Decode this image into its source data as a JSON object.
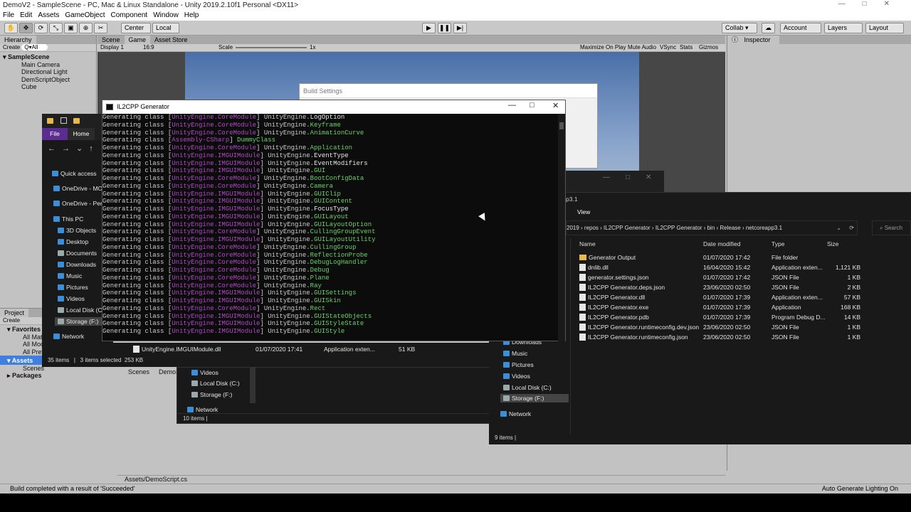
{
  "window": {
    "title": "DemoV2 - SampleScene - PC, Mac & Linux Standalone - Unity 2019.2.10f1 Personal <DX11>"
  },
  "menu": [
    "File",
    "Edit",
    "Assets",
    "GameObject",
    "Component",
    "Window",
    "Help"
  ],
  "toolbar": {
    "center": "Center",
    "local": "Local",
    "collab": "Collab ▾",
    "account": "Account",
    "layers": "Layers",
    "layout": "Layout"
  },
  "tabs": {
    "scene": "Scene",
    "game": "Game",
    "asset_store": "Asset Store",
    "hierarchy": "Hierarchy",
    "inspector": "Inspector",
    "project": "Project"
  },
  "game_bar": {
    "display": "Display 1",
    "aspect": "16:9",
    "scale_label": "Scale",
    "scale_value": "1x",
    "buttons": [
      "Maximize On Play",
      "Mute Audio",
      "VSync",
      "Stats",
      "Gizmos"
    ]
  },
  "hierarchy": {
    "create": "Create",
    "search": "Q▾All",
    "scene": "SampleScene",
    "items": [
      "Main Camera",
      "Directional Light",
      "DemScriptObject",
      "Cube"
    ]
  },
  "project": {
    "create": "Create",
    "favorites": "Favorites",
    "fav_items": [
      "All Mat",
      "All Mod",
      "All Pref"
    ],
    "assets": "Assets",
    "asset_items": [
      "Scenes"
    ],
    "packages": "Packages",
    "right_items": [
      "Scenes",
      "DemoS"
    ],
    "bottom_path": "Assets/DemoScript.cs"
  },
  "build_settings": {
    "title": "Build Settings"
  },
  "status": {
    "text": "Build completed with a result of 'Succeeded'",
    "right": "Auto Generate Lighting On"
  },
  "console": {
    "title": "IL2CPP Generator",
    "lines": [
      {
        "p": "Generating class [",
        "mod": "UnityEngine.CoreModule",
        "mid": "] UnityEngine.",
        "name": "LogOption",
        "nc": "w"
      },
      {
        "p": "Generating class [",
        "mod": "UnityEngine.CoreModule",
        "mid": "] UnityEngine.",
        "name": "Keyframe",
        "nc": "g2"
      },
      {
        "p": "Generating class [",
        "mod": "UnityEngine.CoreModule",
        "mid": "] UnityEngine.",
        "name": "AnimationCurve",
        "nc": "g2"
      },
      {
        "p": "Generating class [",
        "mod": "Assembly-CSharp",
        "mid": "] ",
        "name": "DummyClass",
        "nc": "g2"
      },
      {
        "p": "Generating class [",
        "mod": "UnityEngine.CoreModule",
        "mid": "] UnityEngine.",
        "name": "Application",
        "nc": "g2"
      },
      {
        "p": "Generating class [",
        "mod": "UnityEngine.IMGUIModule",
        "mid": "] UnityEngine.",
        "name": "EventType",
        "nc": "w"
      },
      {
        "p": "Generating class [",
        "mod": "UnityEngine.IMGUIModule",
        "mid": "] UnityEngine.",
        "name": "EventModifiers",
        "nc": "w"
      },
      {
        "p": "Generating class [",
        "mod": "UnityEngine.IMGUIModule",
        "mid": "] UnityEngine.",
        "name": "GUI",
        "nc": "g2"
      },
      {
        "p": "Generating class [",
        "mod": "UnityEngine.CoreModule",
        "mid": "] UnityEngine.",
        "name": "BootConfigData",
        "nc": "g2"
      },
      {
        "p": "Generating class [",
        "mod": "UnityEngine.CoreModule",
        "mid": "] UnityEngine.",
        "name": "Camera",
        "nc": "g2"
      },
      {
        "p": "Generating class [",
        "mod": "UnityEngine.IMGUIModule",
        "mid": "] UnityEngine.",
        "name": "GUIClip",
        "nc": "g2"
      },
      {
        "p": "Generating class [",
        "mod": "UnityEngine.IMGUIModule",
        "mid": "] UnityEngine.",
        "name": "GUIContent",
        "nc": "g2"
      },
      {
        "p": "Generating class [",
        "mod": "UnityEngine.IMGUIModule",
        "mid": "] UnityEngine.",
        "name": "FocusType",
        "nc": "w"
      },
      {
        "p": "Generating class [",
        "mod": "UnityEngine.IMGUIModule",
        "mid": "] UnityEngine.",
        "name": "GUILayout",
        "nc": "g2"
      },
      {
        "p": "Generating class [",
        "mod": "UnityEngine.IMGUIModule",
        "mid": "] UnityEngine.",
        "name": "GUILayoutOption",
        "nc": "g2"
      },
      {
        "p": "Generating class [",
        "mod": "UnityEngine.CoreModule",
        "mid": "] UnityEngine.",
        "name": "CullingGroupEvent",
        "nc": "g2"
      },
      {
        "p": "Generating class [",
        "mod": "UnityEngine.IMGUIModule",
        "mid": "] UnityEngine.",
        "name": "GUILayoutUtility",
        "nc": "g2"
      },
      {
        "p": "Generating class [",
        "mod": "UnityEngine.CoreModule",
        "mid": "] UnityEngine.",
        "name": "CullingGroup",
        "nc": "g2"
      },
      {
        "p": "Generating class [",
        "mod": "UnityEngine.CoreModule",
        "mid": "] UnityEngine.",
        "name": "ReflectionProbe",
        "nc": "g2"
      },
      {
        "p": "Generating class [",
        "mod": "UnityEngine.CoreModule",
        "mid": "] UnityEngine.",
        "name": "DebugLogHandler",
        "nc": "g2"
      },
      {
        "p": "Generating class [",
        "mod": "UnityEngine.CoreModule",
        "mid": "] UnityEngine.",
        "name": "Debug",
        "nc": "g2"
      },
      {
        "p": "Generating class [",
        "mod": "UnityEngine.CoreModule",
        "mid": "] UnityEngine.",
        "name": "Plane",
        "nc": "g2"
      },
      {
        "p": "Generating class [",
        "mod": "UnityEngine.CoreModule",
        "mid": "] UnityEngine.",
        "name": "Ray",
        "nc": "g2"
      },
      {
        "p": "Generating class [",
        "mod": "UnityEngine.IMGUIModule",
        "mid": "] UnityEngine.",
        "name": "GUISettings",
        "nc": "g2"
      },
      {
        "p": "Generating class [",
        "mod": "UnityEngine.IMGUIModule",
        "mid": "] UnityEngine.",
        "name": "GUISkin",
        "nc": "g2"
      },
      {
        "p": "Generating class [",
        "mod": "UnityEngine.CoreModule",
        "mid": "] UnityEngine.",
        "name": "Rect",
        "nc": "g2"
      },
      {
        "p": "Generating class [",
        "mod": "UnityEngine.IMGUIModule",
        "mid": "] UnityEngine.",
        "name": "GUIStateObjects",
        "nc": "g2"
      },
      {
        "p": "Generating class [",
        "mod": "UnityEngine.IMGUIModule",
        "mid": "] UnityEngine.",
        "name": "GUIStyleState",
        "nc": "g2"
      },
      {
        "p": "Generating class [",
        "mod": "UnityEngine.IMGUIModule",
        "mid": "] UnityEngine.",
        "name": "GUIStyle",
        "nc": "g2"
      }
    ]
  },
  "explorer_left": {
    "ribbon": {
      "file": "File",
      "home": "Home"
    },
    "nav": [
      "Quick access",
      "OneDrive - MO",
      "OneDrive - Pers",
      "This PC",
      "3D Objects",
      "Desktop",
      "Documents",
      "Downloads",
      "Music",
      "Pictures",
      "Videos",
      "Local Disk (C:)",
      "Storage (F:)",
      "Network"
    ],
    "status": "35 items   |   3 items selected  253 KB",
    "file_row": {
      "name": "UnityEngine.IMGUIModule.dll",
      "date": "01/07/2020 17:41",
      "type": "Application exten...",
      "size": "51 KB"
    }
  },
  "explorer_mid": {
    "nav": [
      "Videos",
      "Local Disk (C:)",
      "Storage (F:)",
      "Network"
    ],
    "status": "10 items  |"
  },
  "explorer_right": {
    "tab": "View",
    "tab_prefix": "p3.1",
    "path": [
      "2019",
      "repos",
      "IL2CPP Generator",
      "IL2CPP Generator",
      "bin",
      "Release",
      "netcoreapp3.1"
    ],
    "search": "Search",
    "columns": [
      "Name",
      "Date modified",
      "Type",
      "Size"
    ],
    "files": [
      {
        "name": "Generator Output",
        "date": "01/07/2020 17:42",
        "type": "File folder",
        "size": "",
        "kind": "folder"
      },
      {
        "name": "dnlib.dll",
        "date": "16/04/2020 15:42",
        "type": "Application exten...",
        "size": "1,121 KB",
        "kind": "file"
      },
      {
        "name": "generator.settings.json",
        "date": "01/07/2020 17:42",
        "type": "JSON File",
        "size": "1 KB",
        "kind": "file"
      },
      {
        "name": "IL2CPP Generator.deps.json",
        "date": "23/06/2020 02:50",
        "type": "JSON File",
        "size": "2 KB",
        "kind": "file"
      },
      {
        "name": "IL2CPP Generator.dll",
        "date": "01/07/2020 17:39",
        "type": "Application exten...",
        "size": "57 KB",
        "kind": "file"
      },
      {
        "name": "IL2CPP Generator.exe",
        "date": "01/07/2020 17:39",
        "type": "Application",
        "size": "168 KB",
        "kind": "file"
      },
      {
        "name": "IL2CPP Generator.pdb",
        "date": "01/07/2020 17:39",
        "type": "Program Debug D...",
        "size": "14 KB",
        "kind": "file"
      },
      {
        "name": "IL2CPP Generator.runtimeconfig.dev.json",
        "date": "23/06/2020 02:50",
        "type": "JSON File",
        "size": "1 KB",
        "kind": "file"
      },
      {
        "name": "IL2CPP Generator.runtimeconfig.json",
        "date": "23/06/2020 02:50",
        "type": "JSON File",
        "size": "1 KB",
        "kind": "file"
      }
    ],
    "nav": [
      "Downloads",
      "Music",
      "Pictures",
      "Videos",
      "Local Disk (C:)",
      "Storage (F:)",
      "Network"
    ],
    "status": "9 items   |"
  },
  "colors": {
    "console_bg": "#0c0c0c",
    "module": "#b148c6",
    "classname": "#13c313",
    "explorer_bg": "#191919",
    "unity_panel": "#c2c2c2",
    "sky_top": "#4a6fa8"
  }
}
